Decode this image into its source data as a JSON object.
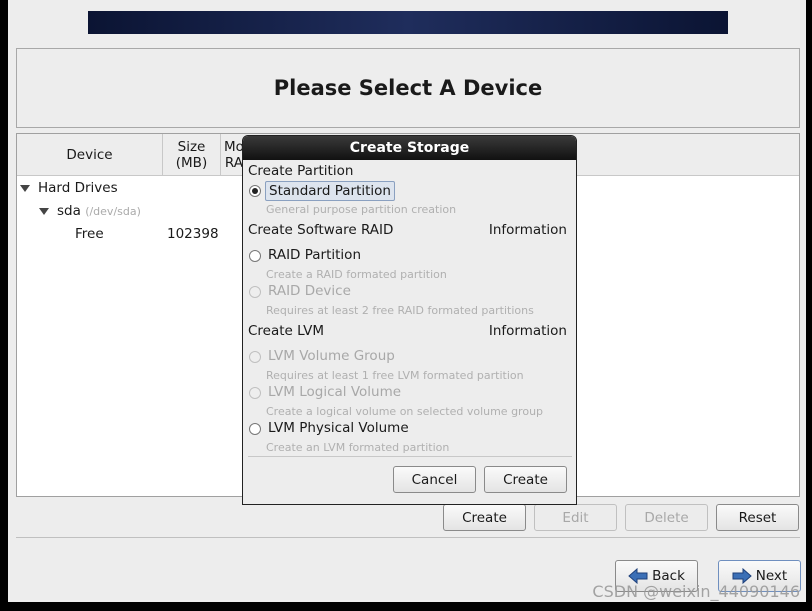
{
  "header": {
    "title": "Please Select A Device"
  },
  "table": {
    "columns": [
      "Device",
      "Size\n(MB)",
      "Mo\nRA"
    ],
    "rows": [
      {
        "device": "Hard Drives",
        "size": ""
      },
      {
        "device": "sda",
        "path": "(/dev/sda)",
        "size": ""
      },
      {
        "device": "Free",
        "size": "102398"
      }
    ]
  },
  "actions": {
    "create": "Create",
    "edit": "Edit",
    "delete": "Delete",
    "reset": "Reset"
  },
  "nav": {
    "back": "Back",
    "next": "Next"
  },
  "dialog": {
    "title": "Create Storage",
    "partition_heading": "Create Partition",
    "standard": {
      "label": "Standard Partition",
      "desc": "General purpose partition creation",
      "selected": true
    },
    "raid_heading": "Create Software RAID",
    "raid_info": "Information",
    "raid_partition": {
      "label": "RAID Partition",
      "desc": "Create a RAID formated partition"
    },
    "raid_device": {
      "label": "RAID Device",
      "desc": "Requires at least 2 free RAID formated partitions"
    },
    "lvm_heading": "Create LVM",
    "lvm_info": "Information",
    "lvm_vg": {
      "label": "LVM Volume Group",
      "desc": "Requires at least 1 free LVM formated partition"
    },
    "lvm_lv": {
      "label": "LVM Logical Volume",
      "desc": "Create a logical volume on selected volume group"
    },
    "lvm_pv": {
      "label": "LVM Physical Volume",
      "desc": "Create an LVM formated partition"
    },
    "cancel": "Cancel",
    "create": "Create"
  },
  "watermark": "CSDN @weixin_44090146"
}
